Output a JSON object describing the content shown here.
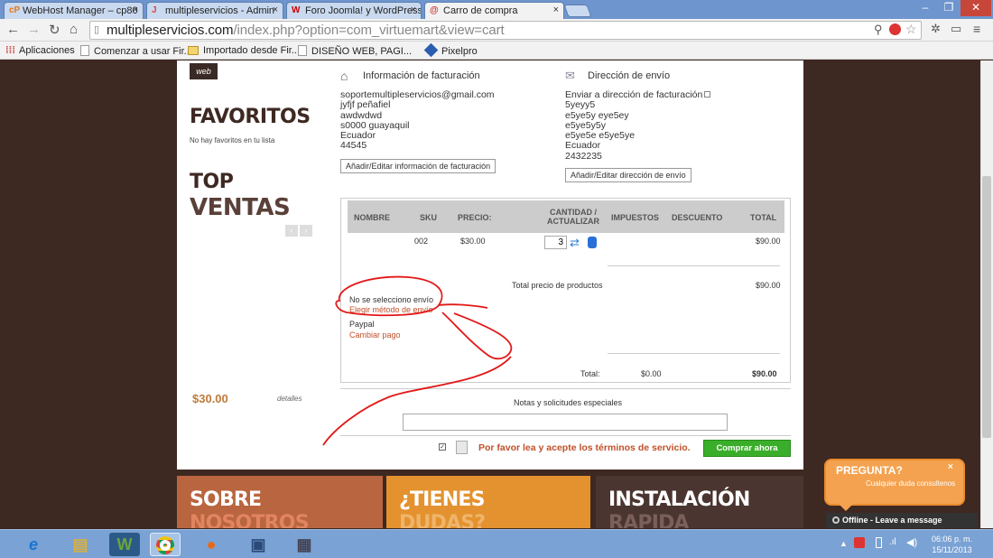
{
  "browser": {
    "tabs": [
      {
        "favicon": "cP",
        "title": "WebHost Manager – cp80",
        "active": false
      },
      {
        "favicon": "J",
        "title": "multipleservicios - Admin",
        "active": false
      },
      {
        "favicon": "W",
        "title": "Foro Joomla! y WordPress",
        "active": false
      },
      {
        "favicon": "@",
        "title": "Carro de compra",
        "active": true
      }
    ],
    "url_host": "multipleservicios.com",
    "url_path": "/index.php?option=com_virtuemart&view=cart",
    "bookmarks": [
      {
        "label": "Aplicaciones",
        "icon": "apps-grid-icon"
      },
      {
        "label": "Comenzar a usar Fir...",
        "icon": "page-icon"
      },
      {
        "label": "Importado desde Fir...",
        "icon": "folder-icon"
      },
      {
        "label": "DISEÑO WEB, PAGI...",
        "icon": "page-icon"
      },
      {
        "label": "Pixelpro",
        "icon": "pixelpro-icon"
      }
    ]
  },
  "sidebar": {
    "web_tag": "web",
    "favoritos_title": "FAVORITOS",
    "favoritos_empty": "No hay favoritos en tu lista",
    "top_line1": "TOP",
    "top_line2": "VENTAS",
    "price": "$30.00",
    "details": "detalles"
  },
  "billing": {
    "title": "Información de facturación",
    "lines": [
      "soportemultipleservicios@gmail.com",
      "jyfjf peñafiel",
      "awdwdwd",
      "s0000 guayaquil",
      "Ecuador",
      "44545"
    ],
    "button": "Añadir/Editar información de facturación"
  },
  "shipping": {
    "title": "Dirección de envío",
    "same_as_billing": "Enviar a dirección de facturación",
    "lines": [
      "5yeyy5",
      "e5ye5y eye5ey",
      "e5ye5y5y",
      "e5ye5e e5ye5ye",
      "Ecuador",
      "2432235"
    ],
    "button": "Añadir/Editar dirección de envío"
  },
  "cart": {
    "headers": {
      "name": "NOMBRE",
      "sku": "SKU",
      "price": "PRECIO:",
      "qty1": "CANTIDAD /",
      "qty2": "ACTUALIZAR",
      "tax": "IMPUESTOS",
      "discount": "DESCUENTO",
      "total": "TOTAL"
    },
    "row": {
      "sku": "002",
      "price": "$30.00",
      "qty": "3",
      "total": "$90.00"
    },
    "products_total_label": "Total precio de productos",
    "products_total": "$90.00",
    "shipping_none": "No se selecciono envío",
    "shipping_link": "Elegir método de envío",
    "payment": "Paypal",
    "payment_link": "Cambiar pago",
    "grand_label": "Total:",
    "grand_tax": "$0.00",
    "grand_total": "$90.00"
  },
  "notes_label": "Notas y solicitudes especiales",
  "tos_text": "Por favor lea y acepte los términos de servicio.",
  "buy_button": "Comprar ahora",
  "footer_panels": [
    {
      "line1": "SOBRE",
      "line2": "NOSOTROS",
      "color": "#b9653f"
    },
    {
      "line1": "¿TIENES",
      "line2": "DUDAS?",
      "color": "#e3922f"
    },
    {
      "line1": "INSTALACIÓN",
      "line2": "RAPIDA",
      "color": "#4a3530"
    }
  ],
  "chat": {
    "title": "PREGUNTA?",
    "subtitle": "Cualquier duda consultenos",
    "close": "×",
    "offline": "Offline - Leave a message"
  },
  "clock": {
    "time": "06:06 p. m.",
    "date": "15/11/2013"
  }
}
